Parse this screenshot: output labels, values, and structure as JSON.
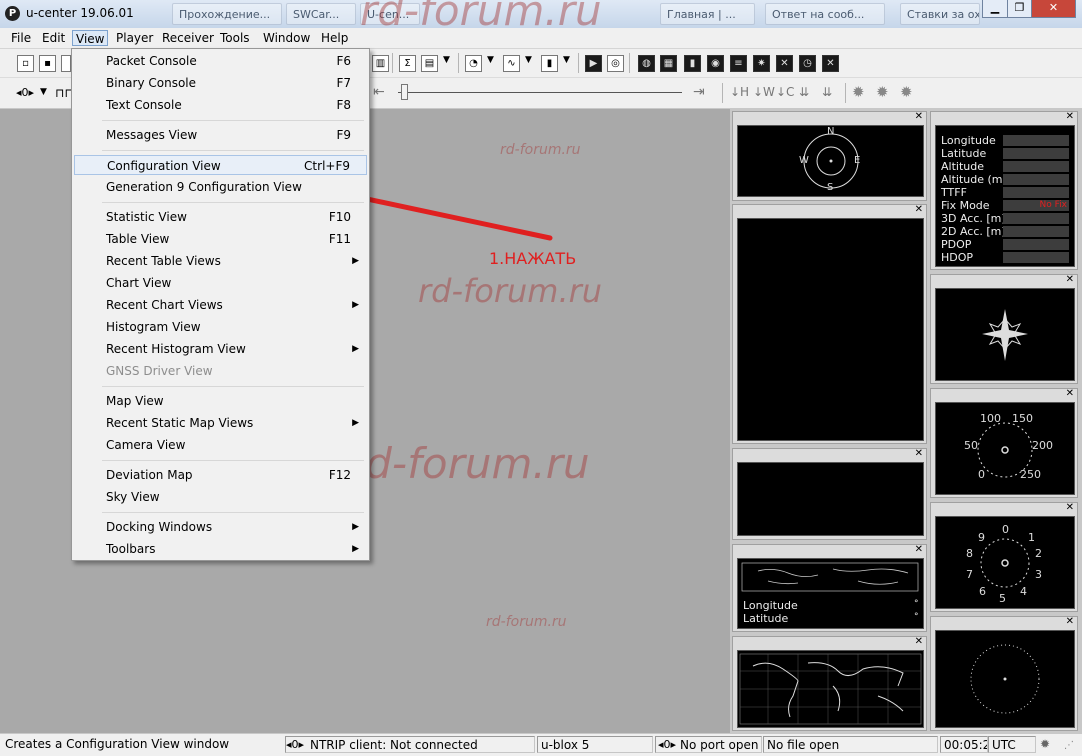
{
  "window": {
    "title": "u-center 19.06.01",
    "app_icon": "P",
    "taskbar_tabs": [
      "Прохождение...",
      "SWCar...",
      "U-cen...",
      "Главная | ...",
      "Ответ на сооб...",
      "Ставки за охотн..."
    ]
  },
  "watermark": "rd-forum.ru",
  "menubar": [
    "File",
    "Edit",
    "View",
    "Player",
    "Receiver",
    "Tools",
    "Window",
    "Help"
  ],
  "view_menu": {
    "items": [
      {
        "label": "Packet Console",
        "key": "F6"
      },
      {
        "label": "Binary Console",
        "key": "F7"
      },
      {
        "label": "Text Console",
        "key": "F8"
      },
      {
        "label": "Messages View",
        "key": "F9"
      },
      {
        "label": "Configuration View",
        "key": "Ctrl+F9"
      },
      {
        "label": "Generation 9 Configuration View",
        "key": ""
      },
      {
        "label": "Statistic View",
        "key": "F10"
      },
      {
        "label": "Table View",
        "key": "F11"
      },
      {
        "label": "Recent Table Views",
        "key": ""
      },
      {
        "label": "Chart View",
        "key": ""
      },
      {
        "label": "Recent Chart Views",
        "key": ""
      },
      {
        "label": "Histogram View",
        "key": ""
      },
      {
        "label": "Recent Histogram View",
        "key": ""
      },
      {
        "label": "GNSS Driver View",
        "key": ""
      },
      {
        "label": "Map View",
        "key": ""
      },
      {
        "label": "Recent Static Map Views",
        "key": ""
      },
      {
        "label": "Camera View",
        "key": ""
      },
      {
        "label": "Deviation Map",
        "key": "F12"
      },
      {
        "label": "Sky View",
        "key": ""
      },
      {
        "label": "Docking Windows",
        "key": ""
      },
      {
        "label": "Toolbars",
        "key": ""
      }
    ]
  },
  "annotation": {
    "text": "1.НАЖАТЬ",
    "color": "#e02020"
  },
  "navigation_panel": {
    "labels": [
      "Longitude",
      "Latitude",
      "Altitude",
      "Altitude (msl)",
      "TTFF",
      "Fix Mode",
      "3D Acc. [m]",
      "2D Acc. [m]",
      "PDOP",
      "HDOP"
    ],
    "fix_mode_value": "No Fix"
  },
  "compass": {
    "n": "N",
    "s": "S",
    "e": "E",
    "w": "W"
  },
  "speed_gauge": {
    "ticks": [
      "100",
      "150",
      "50",
      "200",
      "0",
      "250"
    ]
  },
  "clock_gauge": {
    "ticks": [
      "0",
      "1",
      "2",
      "3",
      "4",
      "5",
      "6",
      "7",
      "8",
      "9"
    ]
  },
  "map_panel": {
    "longitude_label": "Longitude",
    "latitude_label": "Latitude",
    "unit": "°"
  },
  "statusbar": {
    "message": "Creates a Configuration View window",
    "ntrip": "NTRIP client: Not connected",
    "device": "u-blox 5",
    "port": "No port open",
    "file": "No file open",
    "time": "00:05:21",
    "timezone": "UTC"
  },
  "colors": {
    "workspace": "#a9a9a9",
    "arrow": "#e02020",
    "highlight": "#dce8f6"
  }
}
